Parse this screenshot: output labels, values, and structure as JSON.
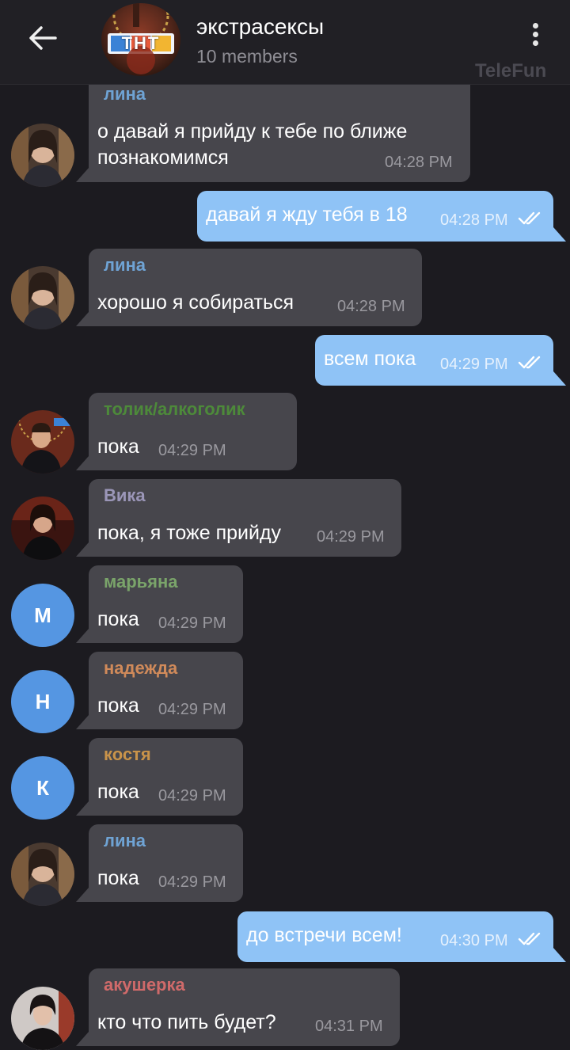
{
  "header": {
    "title": "экстрасексы",
    "subtitle": "10 members",
    "logo_text": "ТНТ",
    "watermark": "TeleFun"
  },
  "colors": {
    "incoming": "#47464c",
    "outgoing": "#8fc3f6",
    "background": "#1c1b20",
    "avatar_letter_bg": "#5596e2"
  },
  "messages": [
    {
      "sender": "лина",
      "text_lines": [
        "о давай я прийду к тебе по ближе",
        "познакомимся"
      ],
      "time": "04:28 PM"
    },
    {
      "text": "давай я жду тебя в 18",
      "time": "04:28 PM"
    },
    {
      "sender": "лина",
      "text": "хорошо я собираться",
      "time": "04:28 PM"
    },
    {
      "text": "всем пока",
      "time": "04:29 PM"
    },
    {
      "sender": "толик/алкоголик",
      "text": "пока",
      "time": "04:29 PM"
    },
    {
      "sender": "Вика",
      "text": "пока, я тоже прийду",
      "time": "04:29 PM"
    },
    {
      "sender": "марьяна",
      "avatar_letter": "М",
      "text": "пока",
      "time": "04:29 PM"
    },
    {
      "sender": "надежда",
      "avatar_letter": "Н",
      "text": "пока",
      "time": "04:29 PM"
    },
    {
      "sender": "костя",
      "avatar_letter": "К",
      "text": "пока",
      "time": "04:29 PM"
    },
    {
      "sender": "лина",
      "text": "пока",
      "time": "04:29 PM"
    },
    {
      "text": "до встречи всем!",
      "time": "04:30 PM"
    },
    {
      "sender": "акушерка",
      "text": "кто что пить будет?",
      "time": "04:31 PM"
    }
  ]
}
